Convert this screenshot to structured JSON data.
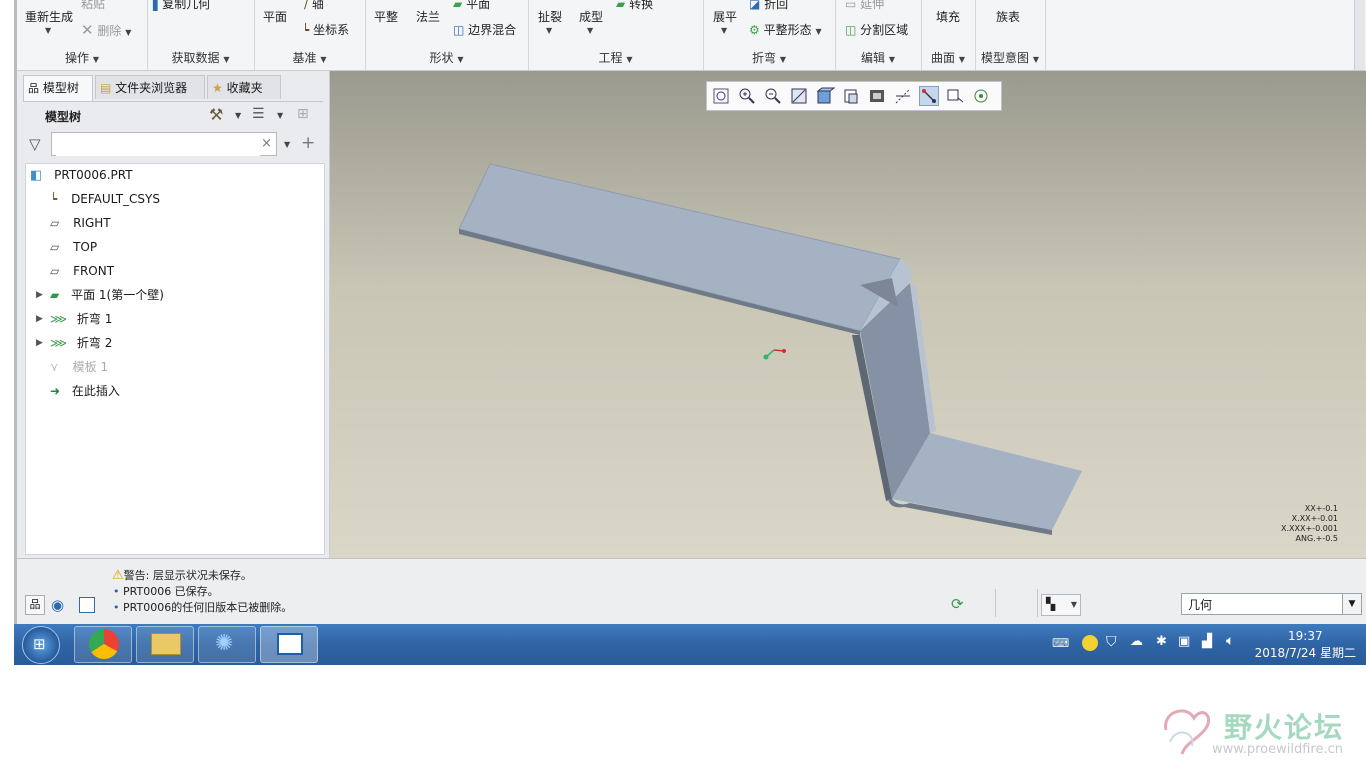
{
  "ribbon": {
    "groups": [
      {
        "label": "操作"
      },
      {
        "label": "获取数据"
      },
      {
        "label": "基准"
      },
      {
        "label": "形状"
      },
      {
        "label": "工程"
      },
      {
        "label": "折弯"
      },
      {
        "label": "编辑"
      },
      {
        "label": "曲面"
      },
      {
        "label": "模型意图"
      }
    ],
    "buttons": {
      "regenerate": "重新生成",
      "paste": "粘贴",
      "delete": "删除",
      "copy_geometry": "复制几何",
      "plane": "平面",
      "axis": "轴",
      "csys": "坐标系",
      "flat": "平整",
      "flange": "法兰",
      "planar": "平面",
      "boundary_blend": "边界混合",
      "rip": "扯裂",
      "form": "成型",
      "convert": "转换",
      "unbend": "展平",
      "bend_back": "折回",
      "flat_pattern": "平整形态",
      "extend": "延伸",
      "split_area": "分割区域",
      "fill": "填充",
      "family_table": "族表"
    }
  },
  "left_panel": {
    "tabs": [
      {
        "label": "模型树",
        "active": true
      },
      {
        "label": "文件夹浏览器",
        "active": false
      },
      {
        "label": "收藏夹",
        "active": false
      }
    ],
    "tree_header": "模型树",
    "search_value": "",
    "tree": [
      {
        "label": "PRT0006.PRT",
        "icon": "part-icon"
      },
      {
        "label": "DEFAULT_CSYS",
        "icon": "csys-icon"
      },
      {
        "label": "RIGHT",
        "icon": "datum-plane-icon"
      },
      {
        "label": "TOP",
        "icon": "datum-plane-icon"
      },
      {
        "label": "FRONT",
        "icon": "datum-plane-icon"
      },
      {
        "label": "平面 1(第一个壁)",
        "icon": "flat-wall-icon"
      },
      {
        "label": "折弯 1",
        "icon": "bend-icon"
      },
      {
        "label": "折弯 2",
        "icon": "bend-icon"
      },
      {
        "label": "模板 1",
        "icon": "template-icon",
        "disabled": true
      },
      {
        "label": "在此插入",
        "icon": "insert-here-icon"
      }
    ]
  },
  "viewport": {
    "tolerances": [
      "XX+-0.1",
      "X.XX+-0.01",
      "X.XXX+-0.001",
      "ANG.+-0.5"
    ],
    "part_color": "#a5b2c4"
  },
  "status_bar": {
    "messages": [
      {
        "text": "警告: 层显示状况未保存。",
        "icon": "warning-icon"
      },
      {
        "text": "PRT0006 已保存。",
        "icon": "bullet"
      },
      {
        "text": "PRT0006的任何旧版本已被删除。",
        "icon": "bullet"
      }
    ],
    "filter_value": "几何"
  },
  "taskbar": {
    "time": "19:37",
    "date": "2018/7/24 星期二"
  },
  "watermark": {
    "name": "野火论坛",
    "url": "www.proewildfire.cn"
  }
}
